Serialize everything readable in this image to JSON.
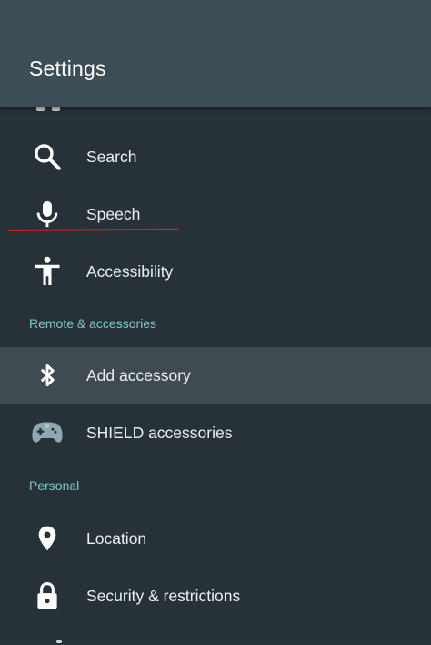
{
  "header": {
    "title": "Settings"
  },
  "items": {
    "search": {
      "label": "Search",
      "icon": "search-icon"
    },
    "speech": {
      "label": "Speech",
      "icon": "microphone-icon"
    },
    "accessibility": {
      "label": "Accessibility",
      "icon": "accessibility-icon"
    },
    "add_accessory": {
      "label": "Add accessory",
      "icon": "bluetooth-icon",
      "selected": true
    },
    "shield_accessories": {
      "label": "SHIELD accessories",
      "icon": "gamepad-icon"
    },
    "location": {
      "label": "Location",
      "icon": "location-pin-icon"
    },
    "security": {
      "label": "Security & restrictions",
      "icon": "lock-icon"
    }
  },
  "sections": {
    "remote": "Remote & accessories",
    "personal": "Personal"
  },
  "colors": {
    "background": "#263238",
    "header": "#3d4d55",
    "selected_row": "#3f4b51",
    "section_label": "#80cbc4",
    "text": "#eceff1",
    "annotation": "#e41b1b"
  }
}
